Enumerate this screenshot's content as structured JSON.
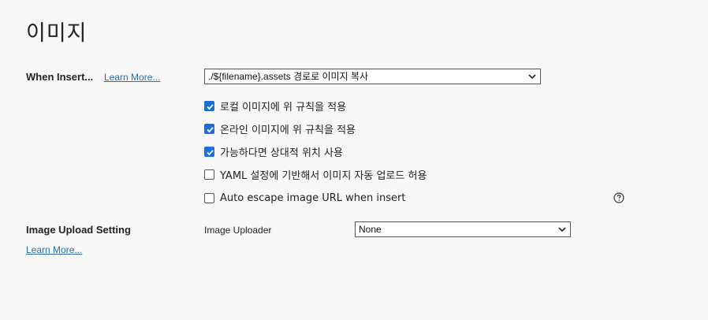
{
  "page": {
    "title": "이미지"
  },
  "when_insert": {
    "label": "When Insert...",
    "learn_more": "Learn More...",
    "select_value": "./${filename}.assets 경로로 이미지 복사",
    "options": [
      {
        "label": "로컬 이미지에 위 규칙을 적용",
        "checked": true
      },
      {
        "label": "온라인 이미지에 위 규칙을 적용",
        "checked": true
      },
      {
        "label": "가능하다면 상대적 위치 사용",
        "checked": true
      },
      {
        "label": "YAML 설정에 기반해서 이미지 자동 업로드 허용",
        "checked": false
      },
      {
        "label": "Auto escape image URL when insert",
        "checked": false
      }
    ]
  },
  "image_upload": {
    "label": "Image Upload Setting",
    "learn_more": "Learn More...",
    "uploader_label": "Image Uploader",
    "uploader_value": "None"
  },
  "icons": {
    "help": "help-circle-icon",
    "chevron": "chevron-down-icon",
    "check": "checkmark-icon"
  },
  "colors": {
    "accent": "#1a6fe0",
    "link": "#2a6db5",
    "background": "#f8f8f8"
  }
}
